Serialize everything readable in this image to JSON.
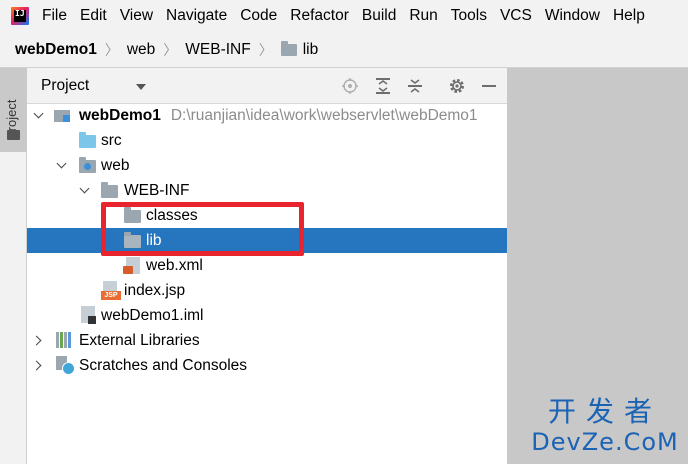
{
  "app": {
    "logo_text": "IJ"
  },
  "menu": [
    "File",
    "Edit",
    "View",
    "Navigate",
    "Code",
    "Refactor",
    "Build",
    "Run",
    "Tools",
    "VCS",
    "Window",
    "Help"
  ],
  "breadcrumb": {
    "project": "webDemo1",
    "item1": "web",
    "item2": "WEB-INF",
    "item3": "lib"
  },
  "toolstrip": {
    "label": "Project"
  },
  "panel": {
    "title": "Project",
    "icons": [
      "locate-icon",
      "expand-all-icon",
      "collapse-all-icon",
      "settings-icon",
      "hide-icon"
    ]
  },
  "tree": {
    "root": {
      "name": "webDemo1",
      "path": "D:\\ruanjian\\idea\\work\\webservlet\\webDemo1"
    },
    "src": "src",
    "web": "web",
    "webinf": "WEB-INF",
    "classes": "classes",
    "lib": "lib",
    "webxml": "web.xml",
    "indexjsp": "index.jsp",
    "jsp_badge": "JSP",
    "iml": "webDemo1.iml",
    "external_libraries": "External Libraries",
    "scratches": "Scratches and Consoles"
  },
  "colors": {
    "selection": "#2675bf",
    "annotation": "#e8242f",
    "watermark": "#1a63b5"
  },
  "watermark": {
    "cn": "开发者",
    "en": "DevZe.CoM"
  }
}
